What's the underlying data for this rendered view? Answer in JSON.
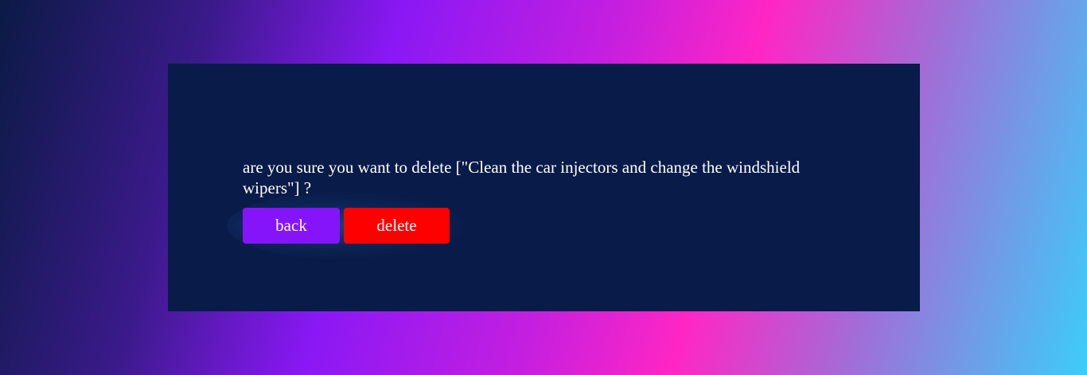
{
  "dialog": {
    "message": "are you sure you want to delete [\"Clean the car injectors and change the windshield wipers\"] ?",
    "back_label": "back",
    "delete_label": "delete"
  },
  "colors": {
    "dialog_bg": "#091b48",
    "back_button": "#8614fb",
    "delete_button": "#ff0000",
    "text": "#ffffff"
  }
}
